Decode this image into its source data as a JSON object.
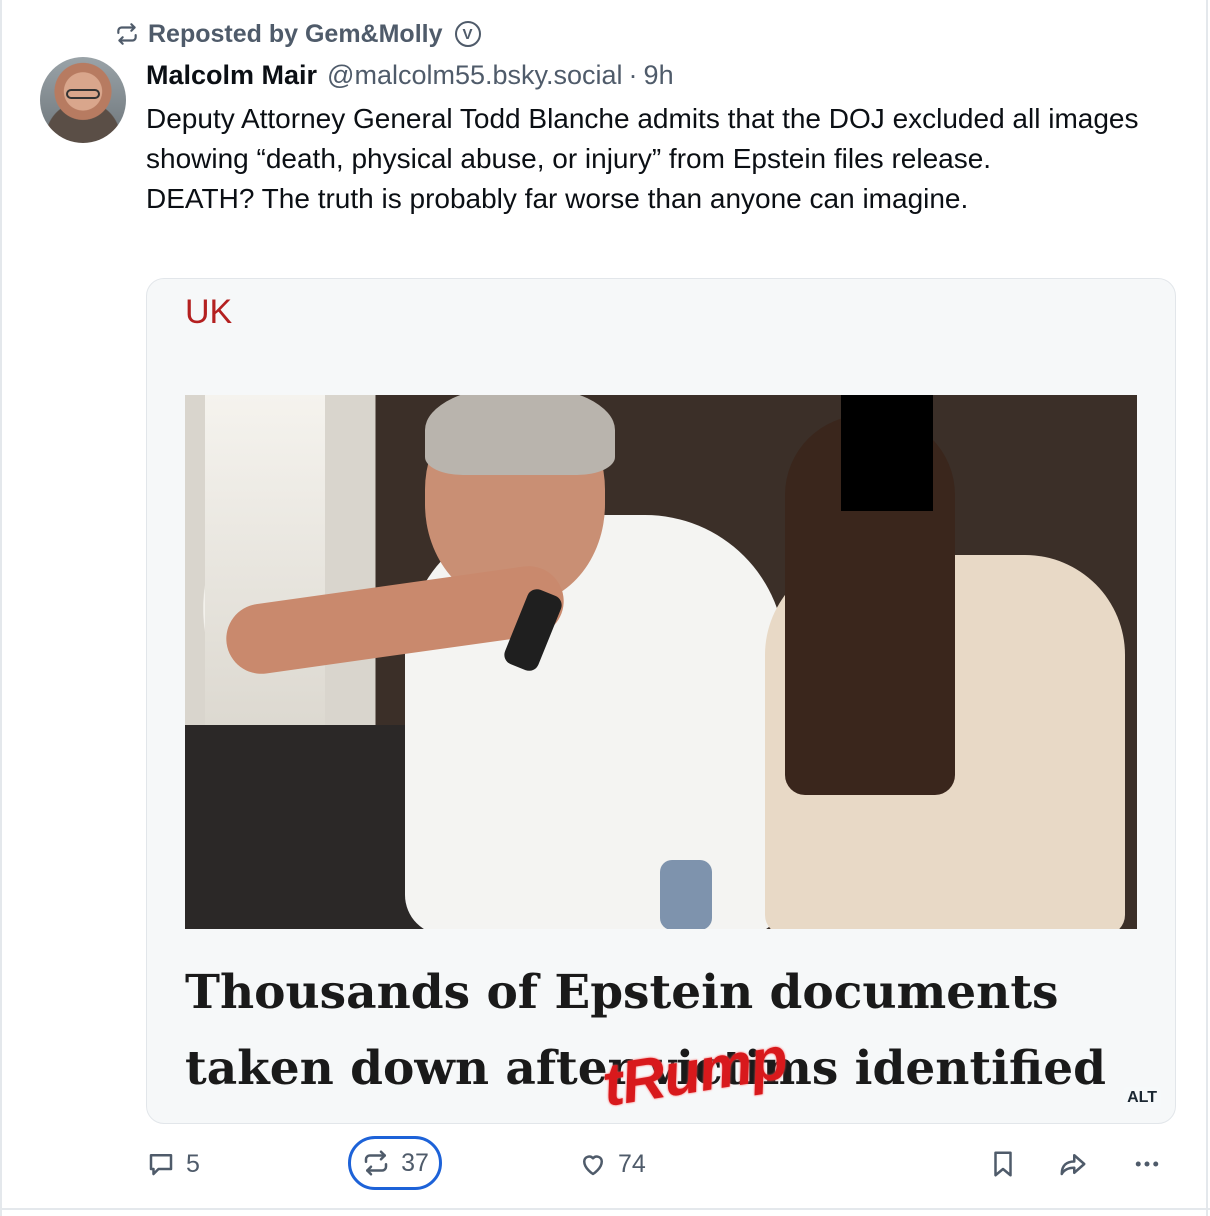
{
  "repost": {
    "text": "Reposted by Gem&Molly",
    "verified_glyph": "V"
  },
  "author": {
    "name": "Malcolm Mair",
    "handle": "@malcolm55.bsky.social",
    "separator": "·",
    "time": "9h"
  },
  "post": {
    "lines": [
      "Deputy Attorney General Todd Blanche  admits that the DOJ excluded all images showing “death, physical abuse, or injury” from Epstein files release.",
      "DEATH? The truth is probably far worse than anyone can imagine."
    ]
  },
  "embed": {
    "section": "UK",
    "headline_lines": [
      "Thousands of Epstein documents",
      "taken down after victims identified"
    ],
    "overlay_word": "tRump",
    "alt_label": "ALT",
    "colors": {
      "section": "#b42020",
      "overlay": "#d8191c"
    }
  },
  "actions": {
    "reply_count": "5",
    "repost_count": "37",
    "like_count": "74",
    "icons": [
      "reply-icon",
      "repost-icon",
      "heart-icon",
      "bookmark-icon",
      "share-icon",
      "more-icon"
    ],
    "accent": "#1d62d8"
  }
}
